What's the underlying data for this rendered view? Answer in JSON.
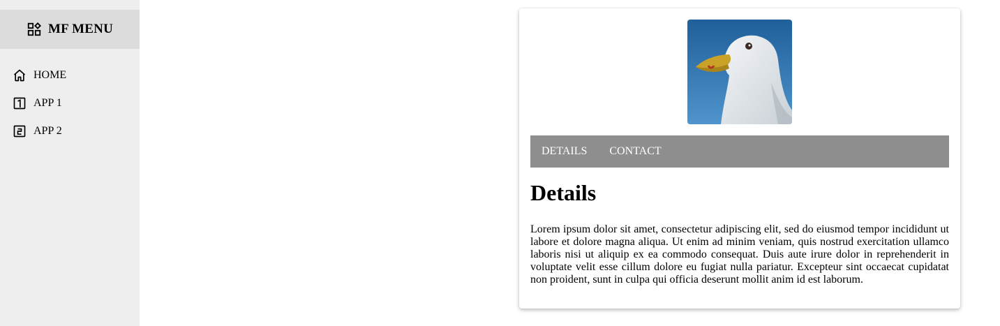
{
  "sidebar": {
    "header": {
      "title": "MF MENU",
      "icon": "dashboard-icon"
    },
    "items": [
      {
        "label": "HOME",
        "icon": "home-icon"
      },
      {
        "label": "APP 1",
        "icon": "box-1-icon"
      },
      {
        "label": "APP 2",
        "icon": "box-2-icon"
      }
    ]
  },
  "card": {
    "image": {
      "subject": "seagull"
    },
    "tabs": [
      {
        "label": "DETAILS"
      },
      {
        "label": "CONTACT"
      }
    ],
    "section_title": "Details",
    "body": "Lorem ipsum dolor sit amet, consectetur adipiscing elit, sed do eiusmod tempor incididunt ut labore et dolore magna aliqua. Ut enim ad minim veniam, quis nostrud exercitation ullamco laboris nisi ut aliquip ex ea commodo consequat. Duis aute irure dolor in reprehenderit in voluptate velit esse cillum dolore eu fugiat nulla pariatur. Excepteur sint occaecat cupidatat non proident, sunt in culpa qui officia deserunt mollit anim id est laborum."
  },
  "colors": {
    "sidebar_bg": "#eeeeee",
    "sidebar_header_bg": "#dcdcdc",
    "tabbar_bg": "#8e8e8e",
    "tab_text": "#ffffff"
  }
}
